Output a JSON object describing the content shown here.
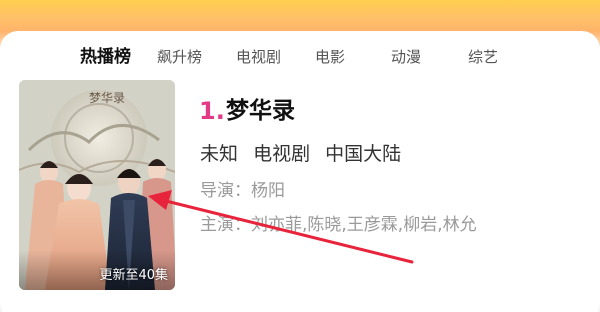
{
  "tabs": [
    {
      "label": "热播榜",
      "active": true
    },
    {
      "label": "飙升榜",
      "active": false
    },
    {
      "label": "电视剧",
      "active": false
    },
    {
      "label": "电影",
      "active": false
    },
    {
      "label": "动漫",
      "active": false
    },
    {
      "label": "综艺",
      "active": false
    }
  ],
  "item": {
    "rank": "1.",
    "title": "梦华录",
    "meta": [
      "未知",
      "电视剧",
      "中国大陆"
    ],
    "director": "导演：杨阳",
    "cast": "主演：刘亦菲,陈晓,王彦霖,柳岩,林允",
    "poster_badge": "更新至40集",
    "poster_logo": "梦华录"
  },
  "colors": {
    "rank": "#e23a86",
    "annotation_arrow": "#e8243c",
    "header_gradient": "#ffc06a"
  }
}
